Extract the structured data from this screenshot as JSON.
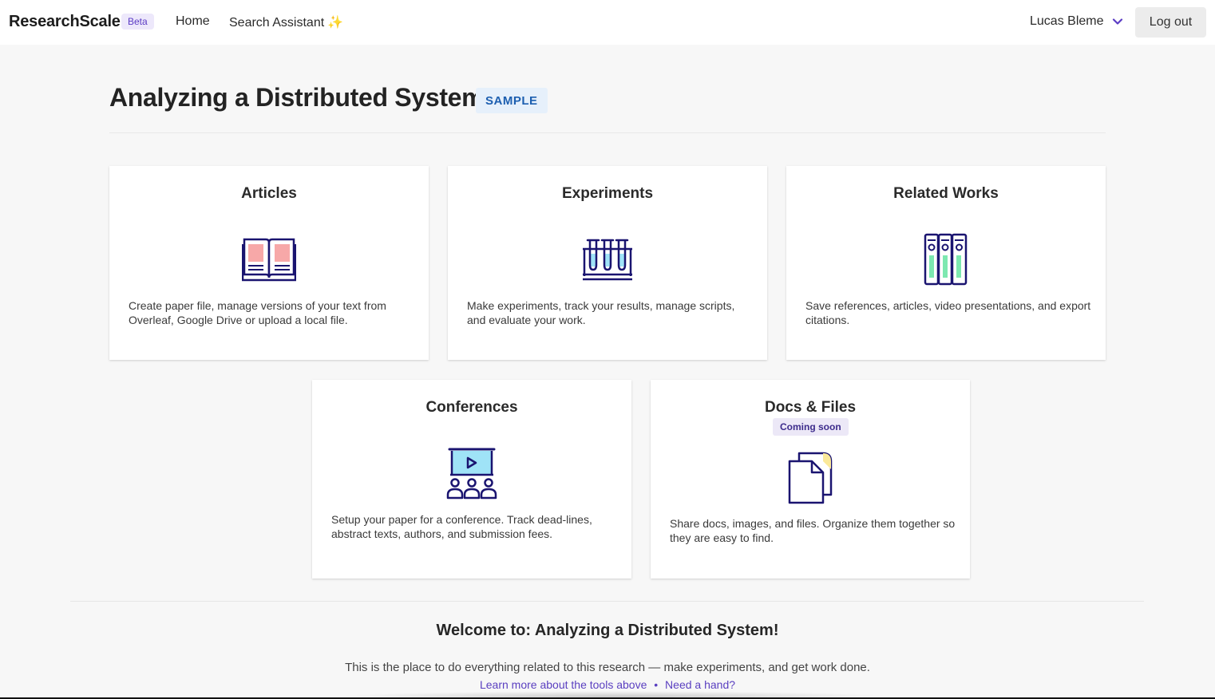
{
  "nav": {
    "brand": "ResearchScale",
    "beta": "Beta",
    "home": "Home",
    "search_assistant": "Search Assistant",
    "sparkle": "✨",
    "user_name": "Lucas Bleme",
    "logout": "Log out"
  },
  "page": {
    "title": "Analyzing a Distributed System",
    "badge": "SAMPLE"
  },
  "cards": [
    {
      "title": "Articles",
      "icon": "open-book-icon",
      "description": "Create paper file, manage versions of your text from Overleaf, Google Drive or upload a local file."
    },
    {
      "title": "Experiments",
      "icon": "test-tubes-icon",
      "description": "Make experiments, track your results, manage scripts, and evaluate your work."
    },
    {
      "title": "Related Works",
      "icon": "binders-icon",
      "description": "Save references, articles, video presentations, and export citations."
    },
    {
      "title": "Conferences",
      "icon": "presentation-audience-icon",
      "description": "Setup your paper for a conference. Track dead-lines, abstract texts, authors, and submission fees."
    },
    {
      "title": "Docs & Files",
      "icon": "documents-icon",
      "badge": "Coming soon",
      "description": "Share docs, images, and files. Organize them together so they are easy to find."
    }
  ],
  "welcome": {
    "heading": "Welcome to: Analyzing a Distributed System!",
    "text": "This is the place to do everything related to this research — make experiments, and get work done.",
    "learn_link": "Learn more about the tools above",
    "separator": "•",
    "help_link": "Need a hand?"
  },
  "colors": {
    "accent": "#5b3cc4",
    "icon_stroke": "#1a1470",
    "pink": "#f7a8a8",
    "blue": "#9fe3f7",
    "green": "#7de8b0",
    "yellow": "#fbe99a"
  }
}
